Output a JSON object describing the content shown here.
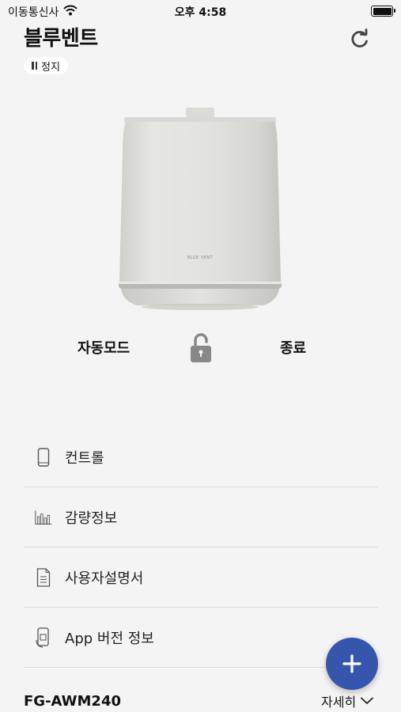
{
  "status": {
    "carrier": "이동통신사",
    "time": "오후 4:58"
  },
  "header": {
    "title": "블루벤트",
    "pause_label": "정지"
  },
  "device": {
    "brand_text": "BLUE VENT"
  },
  "modes": {
    "auto_label": "자동모드",
    "end_label": "종료",
    "lock_icon": "unlock-icon"
  },
  "menu": {
    "items": [
      {
        "label": "컨트롤",
        "icon": "phone-icon"
      },
      {
        "label": "감량정보",
        "icon": "bar-chart-icon"
      },
      {
        "label": "사용자설명서",
        "icon": "document-icon"
      },
      {
        "label": "App 버전 정보",
        "icon": "app-info-icon"
      }
    ]
  },
  "footer": {
    "model": "FG-AWM240",
    "detail_label": "자세히"
  },
  "colors": {
    "accent": "#3656ad",
    "background": "#f4f4f4"
  }
}
